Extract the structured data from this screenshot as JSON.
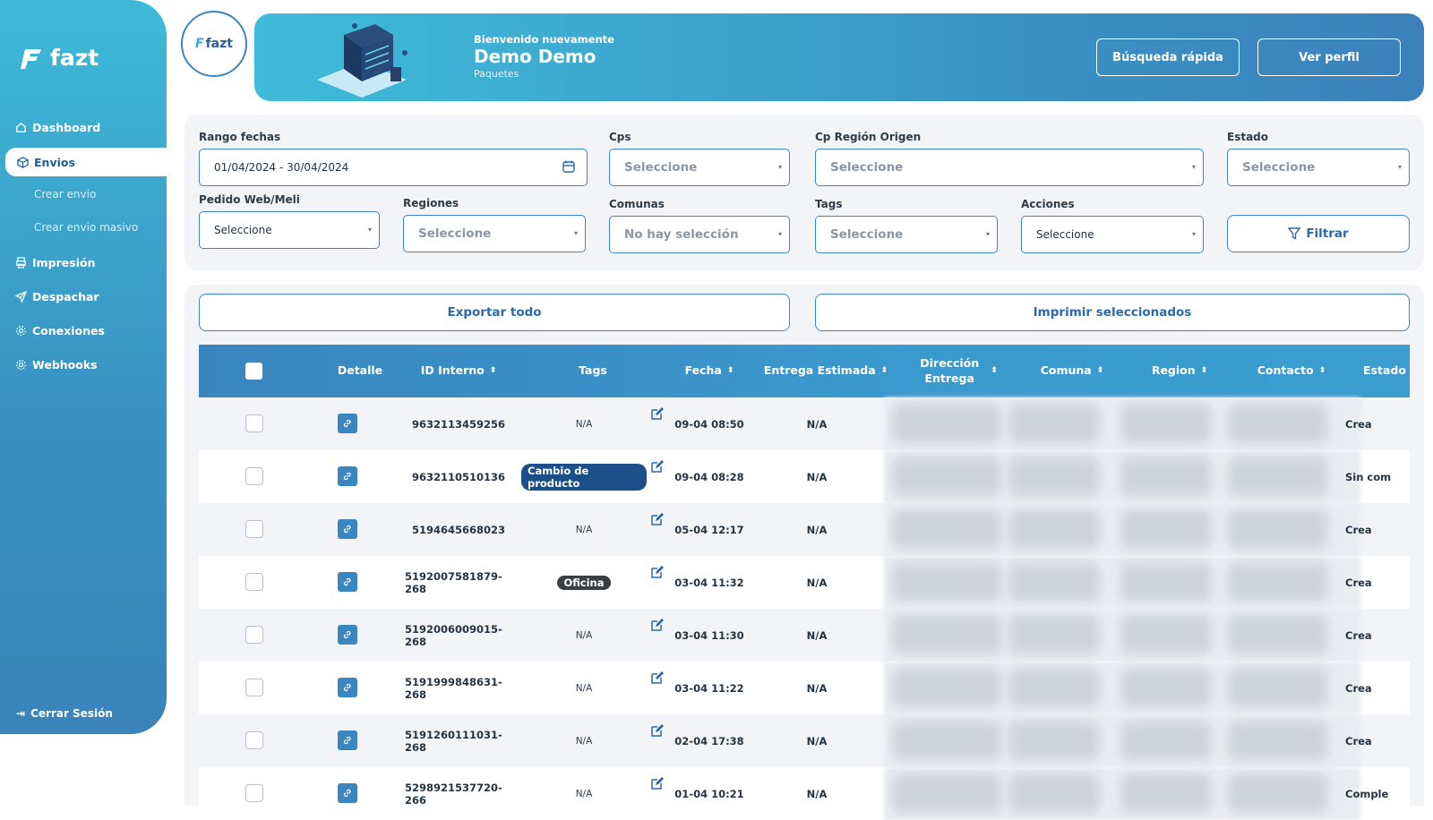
{
  "sidebar": {
    "logo_text": "fazt",
    "items": [
      {
        "label": "Dashboard",
        "icon": "home-icon"
      },
      {
        "label": "Envios",
        "icon": "box-icon"
      },
      {
        "label": "Crear envio"
      },
      {
        "label": "Crear envio masivo"
      },
      {
        "label": "Impresión",
        "icon": "printer-icon"
      },
      {
        "label": "Despachar",
        "icon": "send-icon"
      },
      {
        "label": "Conexiones",
        "icon": "gear-icon"
      },
      {
        "label": "Webhooks",
        "icon": "gear-icon"
      }
    ],
    "logout_label": "Cerrar Sesión"
  },
  "header": {
    "brand_text": "fazt",
    "welcome": "Bienvenido nuevamente",
    "user_name": "Demo Demo",
    "subtitle": "Paquetes",
    "quick_search_label": "Búsqueda rápida",
    "profile_label": "Ver perfil"
  },
  "filters": {
    "date_range": {
      "label": "Rango fechas",
      "value": "01/04/2024 - 30/04/2024"
    },
    "cps": {
      "label": "Cps",
      "value": "Seleccione"
    },
    "cp_region": {
      "label": "Cp Región Origen",
      "value": "Seleccione"
    },
    "estado": {
      "label": "Estado",
      "value": "Seleccione"
    },
    "pedido": {
      "label": "Pedido Web/Meli",
      "value": "Seleccione"
    },
    "regiones": {
      "label": "Regiones",
      "value": "Seleccione"
    },
    "comunas": {
      "label": "Comunas",
      "value": "No hay selección"
    },
    "tags": {
      "label": "Tags",
      "value": "Seleccione"
    },
    "acciones": {
      "label": "Acciones",
      "value": "Seleccione"
    },
    "filter_button": "Filtrar"
  },
  "actions": {
    "export_all": "Exportar todo",
    "print_selected": "Imprimir seleccionados"
  },
  "table": {
    "columns": [
      "Detalle",
      "ID Interno",
      "Tags",
      "Fecha",
      "Entrega Estimada",
      "Dirección Entrega",
      "Comuna",
      "Region",
      "Contacto",
      "Estado"
    ],
    "rows": [
      {
        "id": "9632113459256",
        "tag": "N/A",
        "fecha": "09-04 08:50",
        "entrega": "N/A",
        "estado": "Crea"
      },
      {
        "id": "9632110510136",
        "tag": "Cambio de producto",
        "fecha": "09-04 08:28",
        "entrega": "N/A",
        "estado": "Sin com"
      },
      {
        "id": "5194645668023",
        "tag": "N/A",
        "fecha": "05-04 12:17",
        "entrega": "N/A",
        "estado": "Crea"
      },
      {
        "id": "5192007581879-268",
        "tag": "Oficina",
        "fecha": "03-04 11:32",
        "entrega": "N/A",
        "estado": "Crea"
      },
      {
        "id": "5192006009015-268",
        "tag": "N/A",
        "fecha": "03-04 11:30",
        "entrega": "N/A",
        "estado": "Crea"
      },
      {
        "id": "5191999848631-268",
        "tag": "N/A",
        "fecha": "03-04 11:22",
        "entrega": "N/A",
        "estado": "Crea"
      },
      {
        "id": "5191260111031-268",
        "tag": "N/A",
        "fecha": "02-04 17:38",
        "entrega": "N/A",
        "estado": "Crea"
      },
      {
        "id": "5298921537720-266",
        "tag": "N/A",
        "fecha": "01-04 10:21",
        "entrega": "N/A",
        "estado": "Comple"
      }
    ]
  },
  "colors": {
    "primary": "#3a86c1",
    "sidebar_top": "#3dbad8",
    "tag_blue": "#1b4f8a",
    "tag_dark": "#3a3f45"
  }
}
